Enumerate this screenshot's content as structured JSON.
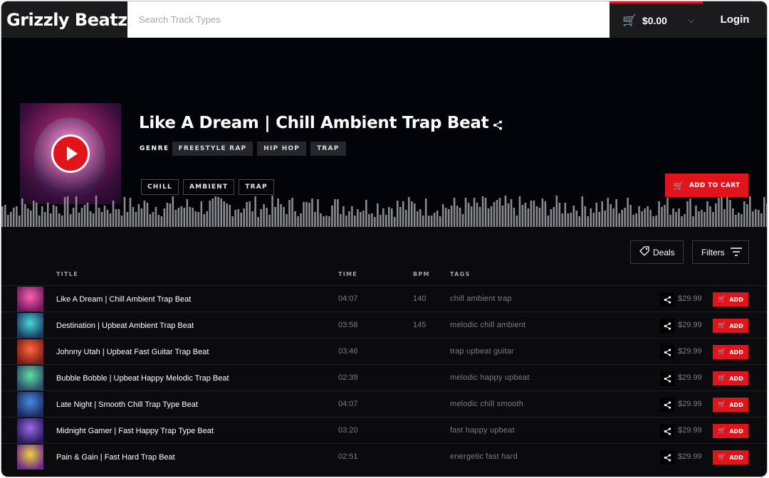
{
  "header": {
    "logo": "Grizzly Beatz",
    "search_placeholder": "Search Track Types",
    "cart_amount": "$0.00",
    "login_label": "Login"
  },
  "hero": {
    "title": "Like A Dream | Chill Ambient Trap Beat",
    "genre_label": "GENRE",
    "genres": [
      "FREESTYLE RAP",
      "HIP HOP",
      "TRAP"
    ],
    "tags": [
      "CHILL",
      "AMBIENT",
      "TRAP"
    ],
    "add_to_cart_label": "ADD TO CART"
  },
  "toolbar": {
    "deals_label": "Deals",
    "filters_label": "Filters"
  },
  "table": {
    "columns": [
      "TITLE",
      "TIME",
      "BPM",
      "TAGS"
    ],
    "add_label": "ADD",
    "rows": [
      {
        "title": "Like A Dream | Chill Ambient Trap Beat",
        "time": "04:07",
        "bpm": "140",
        "tags": "chill ambient trap",
        "price": "$29.99",
        "art": [
          "#ff5fb0",
          "#6a1a5a"
        ]
      },
      {
        "title": "Destination | Upbeat Ambient Trap Beat",
        "time": "03:58",
        "bpm": "145",
        "tags": "melodic chill ambient",
        "price": "$29.99",
        "art": [
          "#46d6e0",
          "#1c3a5a"
        ]
      },
      {
        "title": "Johnny Utah | Upbeat Fast Guitar Trap Beat",
        "time": "03:46",
        "bpm": "",
        "tags": "trap upbeat guitar",
        "price": "$29.99",
        "art": [
          "#ff6a3a",
          "#7a1a1a"
        ]
      },
      {
        "title": "Bubble Bobble | Upbeat Happy Melodic Trap Beat",
        "time": "02:39",
        "bpm": "",
        "tags": "melodic happy upbeat",
        "price": "$29.99",
        "art": [
          "#5ee0a0",
          "#2a4a6a"
        ]
      },
      {
        "title": "Late Night | Smooth Chill Trap Type Beat",
        "time": "04:07",
        "bpm": "",
        "tags": "melodic chill smooth",
        "price": "$29.99",
        "art": [
          "#4a8ae0",
          "#1a2a5a"
        ]
      },
      {
        "title": "Midnight Gamer | Fast Happy Trap Type Beat",
        "time": "03:20",
        "bpm": "",
        "tags": "fast happy upbeat",
        "price": "$29.99",
        "art": [
          "#9a6ae8",
          "#2a1a5a"
        ]
      },
      {
        "title": "Pain & Gain | Fast Hard Trap Beat",
        "time": "02:51",
        "bpm": "",
        "tags": "energetic fast hard",
        "price": "$29.99",
        "art": [
          "#f0d040",
          "#6a2a8a"
        ]
      }
    ]
  },
  "colors": {
    "accent": "#e0141a",
    "background": "#0b0b0d",
    "hero_background": "#03040a",
    "waveform": "#8a8a8e"
  },
  "icons": {
    "cart": "cart-icon",
    "share": "share-icon",
    "play": "play-icon",
    "deals": "tag-icon",
    "filters": "filter-lines-icon",
    "dropdown": "chevron-down-icon"
  }
}
